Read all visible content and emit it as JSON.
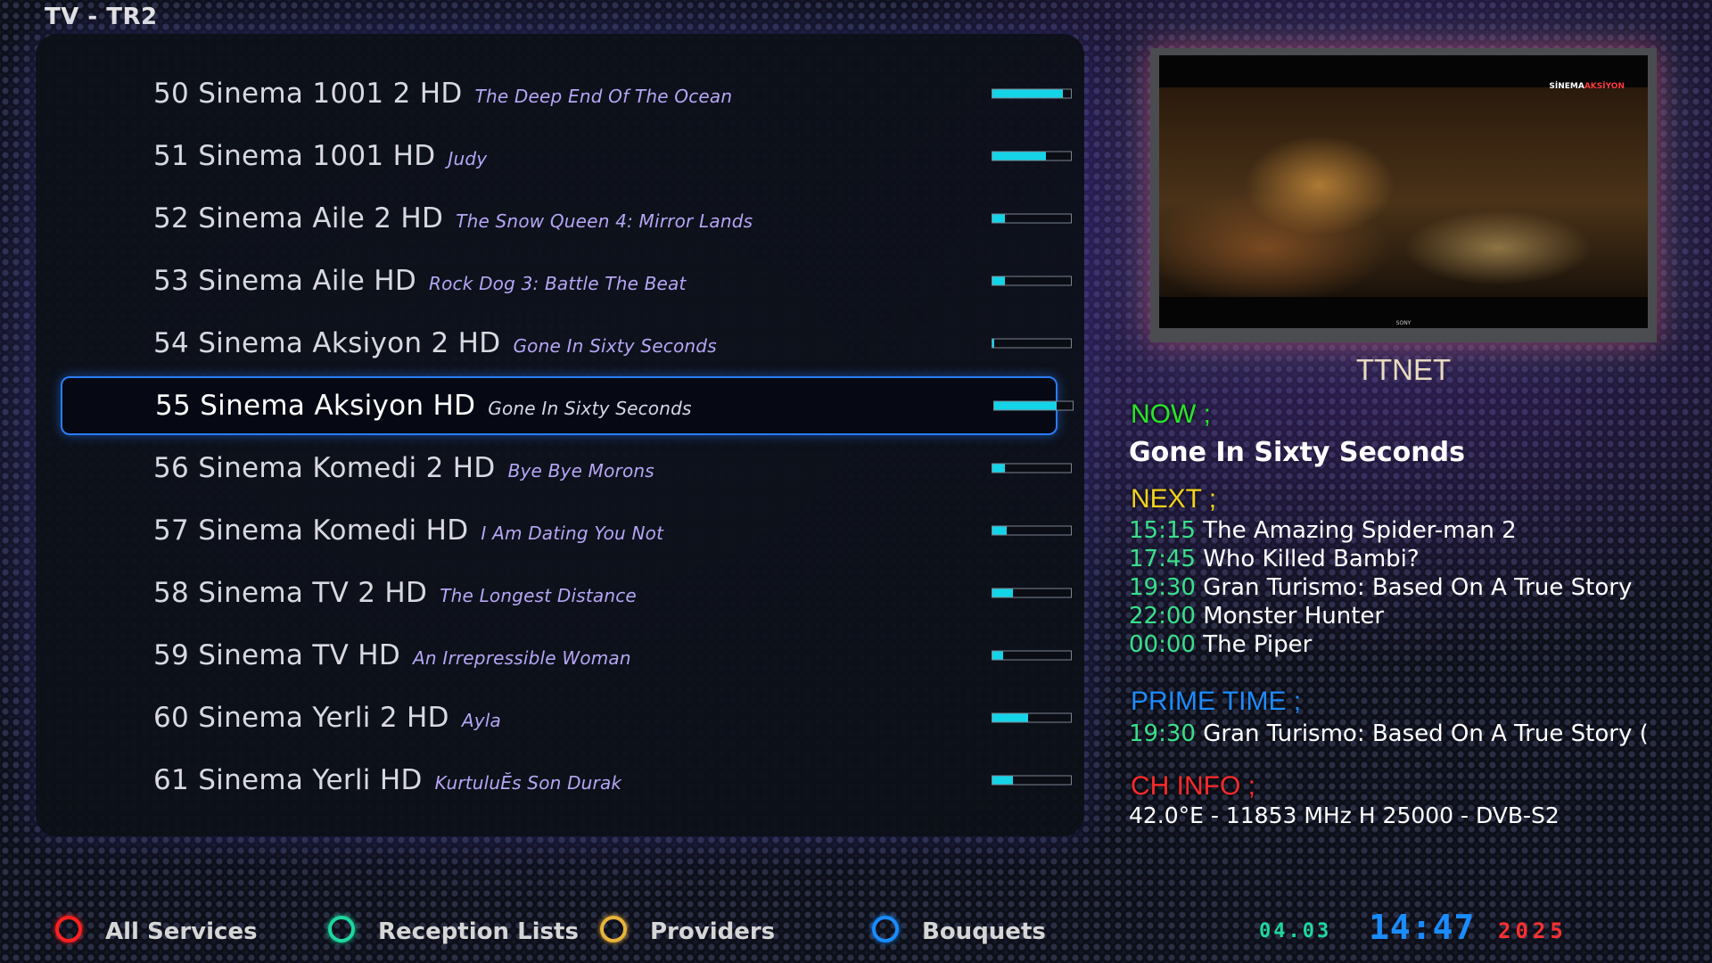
{
  "header": {
    "title": "TV - TR2"
  },
  "channels": [
    {
      "number": "50",
      "name": "Sinema 1001 2 HD",
      "program": "The Deep End Of The Ocean",
      "progress": 0.9
    },
    {
      "number": "51",
      "name": "Sinema 1001 HD",
      "program": "Judy",
      "progress": 0.68
    },
    {
      "number": "52",
      "name": "Sinema Aile 2 HD",
      "program": "The Snow Queen 4: Mirror Lands",
      "progress": 0.16
    },
    {
      "number": "53",
      "name": "Sinema Aile HD",
      "program": "Rock Dog 3:  Battle The Beat",
      "progress": 0.16
    },
    {
      "number": "54",
      "name": "Sinema Aksiyon 2 HD",
      "program": "Gone In Sixty Seconds",
      "progress": 0.02
    },
    {
      "number": "55",
      "name": "Sinema Aksiyon HD",
      "program": "Gone In Sixty Seconds",
      "progress": 0.8
    },
    {
      "number": "56",
      "name": "Sinema Komedi 2 HD",
      "program": "Bye Bye Morons",
      "progress": 0.16
    },
    {
      "number": "57",
      "name": "Sinema Komedi HD",
      "program": "I Am Dating You Not",
      "progress": 0.18
    },
    {
      "number": "58",
      "name": "Sinema TV 2 HD",
      "program": "The Longest Distance",
      "progress": 0.26
    },
    {
      "number": "59",
      "name": "Sinema TV HD",
      "program": "An Irrepressible Woman",
      "progress": 0.14
    },
    {
      "number": "60",
      "name": "Sinema Yerli 2 HD",
      "program": "Ayla",
      "progress": 0.46
    },
    {
      "number": "61",
      "name": "Sinema Yerli HD",
      "program": "KurtuluĔs Son Durak",
      "progress": 0.26
    }
  ],
  "selected_index": 5,
  "preview": {
    "logo_white": "SİNEMA",
    "logo_red": "AKSİYON",
    "maker": "SONY"
  },
  "info": {
    "provider": "TTNET",
    "now_label": "NOW ;",
    "now_title": "Gone In Sixty Seconds",
    "next_label": "NEXT ;",
    "next": [
      {
        "time": "15:15",
        "title": "The Amazing Spider-man 2"
      },
      {
        "time": "17:45",
        "title": "Who Killed Bambi?"
      },
      {
        "time": "19:30",
        "title": "Gran Turismo: Based On A True Story"
      },
      {
        "time": "22:00",
        "title": "Monster Hunter"
      },
      {
        "time": "00:00",
        "title": "The Piper"
      }
    ],
    "prime_label": "PRIME TIME ;",
    "prime": {
      "time": "19:30",
      "title": "Gran Turismo: Based On A True Story ("
    },
    "chinfo_label": "CH INFO ;",
    "chinfo": "42.0°E - 11853 MHz H 25000 - DVB-S2"
  },
  "footer": {
    "buttons": [
      {
        "label": "All Services",
        "color": "#ff2020",
        "icon": "red-ring-icon"
      },
      {
        "label": "Reception Lists",
        "color": "#1fd7a0",
        "icon": "green-ring-icon"
      },
      {
        "label": "Providers",
        "color": "#e8b43a",
        "icon": "yellow-ring-icon"
      },
      {
        "label": "Bouquets",
        "color": "#1a8cff",
        "icon": "blue-ring-icon"
      }
    ],
    "date": "04.03",
    "time": "14:47",
    "year": "2025"
  },
  "colors": {
    "progress": "#14d4e8",
    "now": "#29e629",
    "next": "#f2d21c",
    "prime": "#1e8cff",
    "chinfo": "#ff2a2a",
    "epg_time": "#39e08a",
    "program": "#b5a6f5",
    "selection": "#2a7df5"
  }
}
